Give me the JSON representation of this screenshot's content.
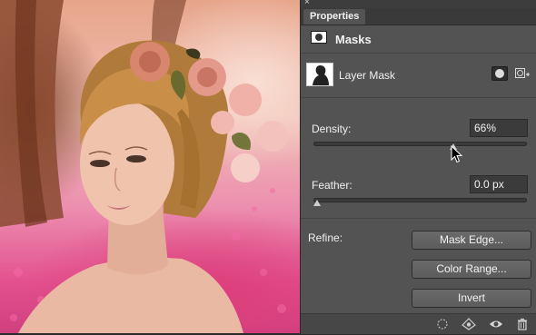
{
  "panel": {
    "close_glyph": "×",
    "tab_label": "Properties",
    "section_title": "Masks",
    "section_icon": "mask-icon",
    "layer_mask_label": "Layer Mask",
    "density": {
      "label": "Density:",
      "value": "66%",
      "level_percent": 66
    },
    "feather": {
      "label": "Feather:",
      "value": "0.0 px",
      "level_percent": 0
    },
    "refine": {
      "label": "Refine:",
      "buttons": [
        "Mask Edge...",
        "Color Range...",
        "Invert"
      ]
    },
    "bottom_icons": [
      "load-selection-icon",
      "apply-mask-icon",
      "visibility-eye-icon",
      "trash-icon"
    ]
  },
  "colors": {
    "panel_bg": "#535353",
    "tab_bar": "#3a3a3a",
    "field_bg": "#3b3b3b"
  }
}
